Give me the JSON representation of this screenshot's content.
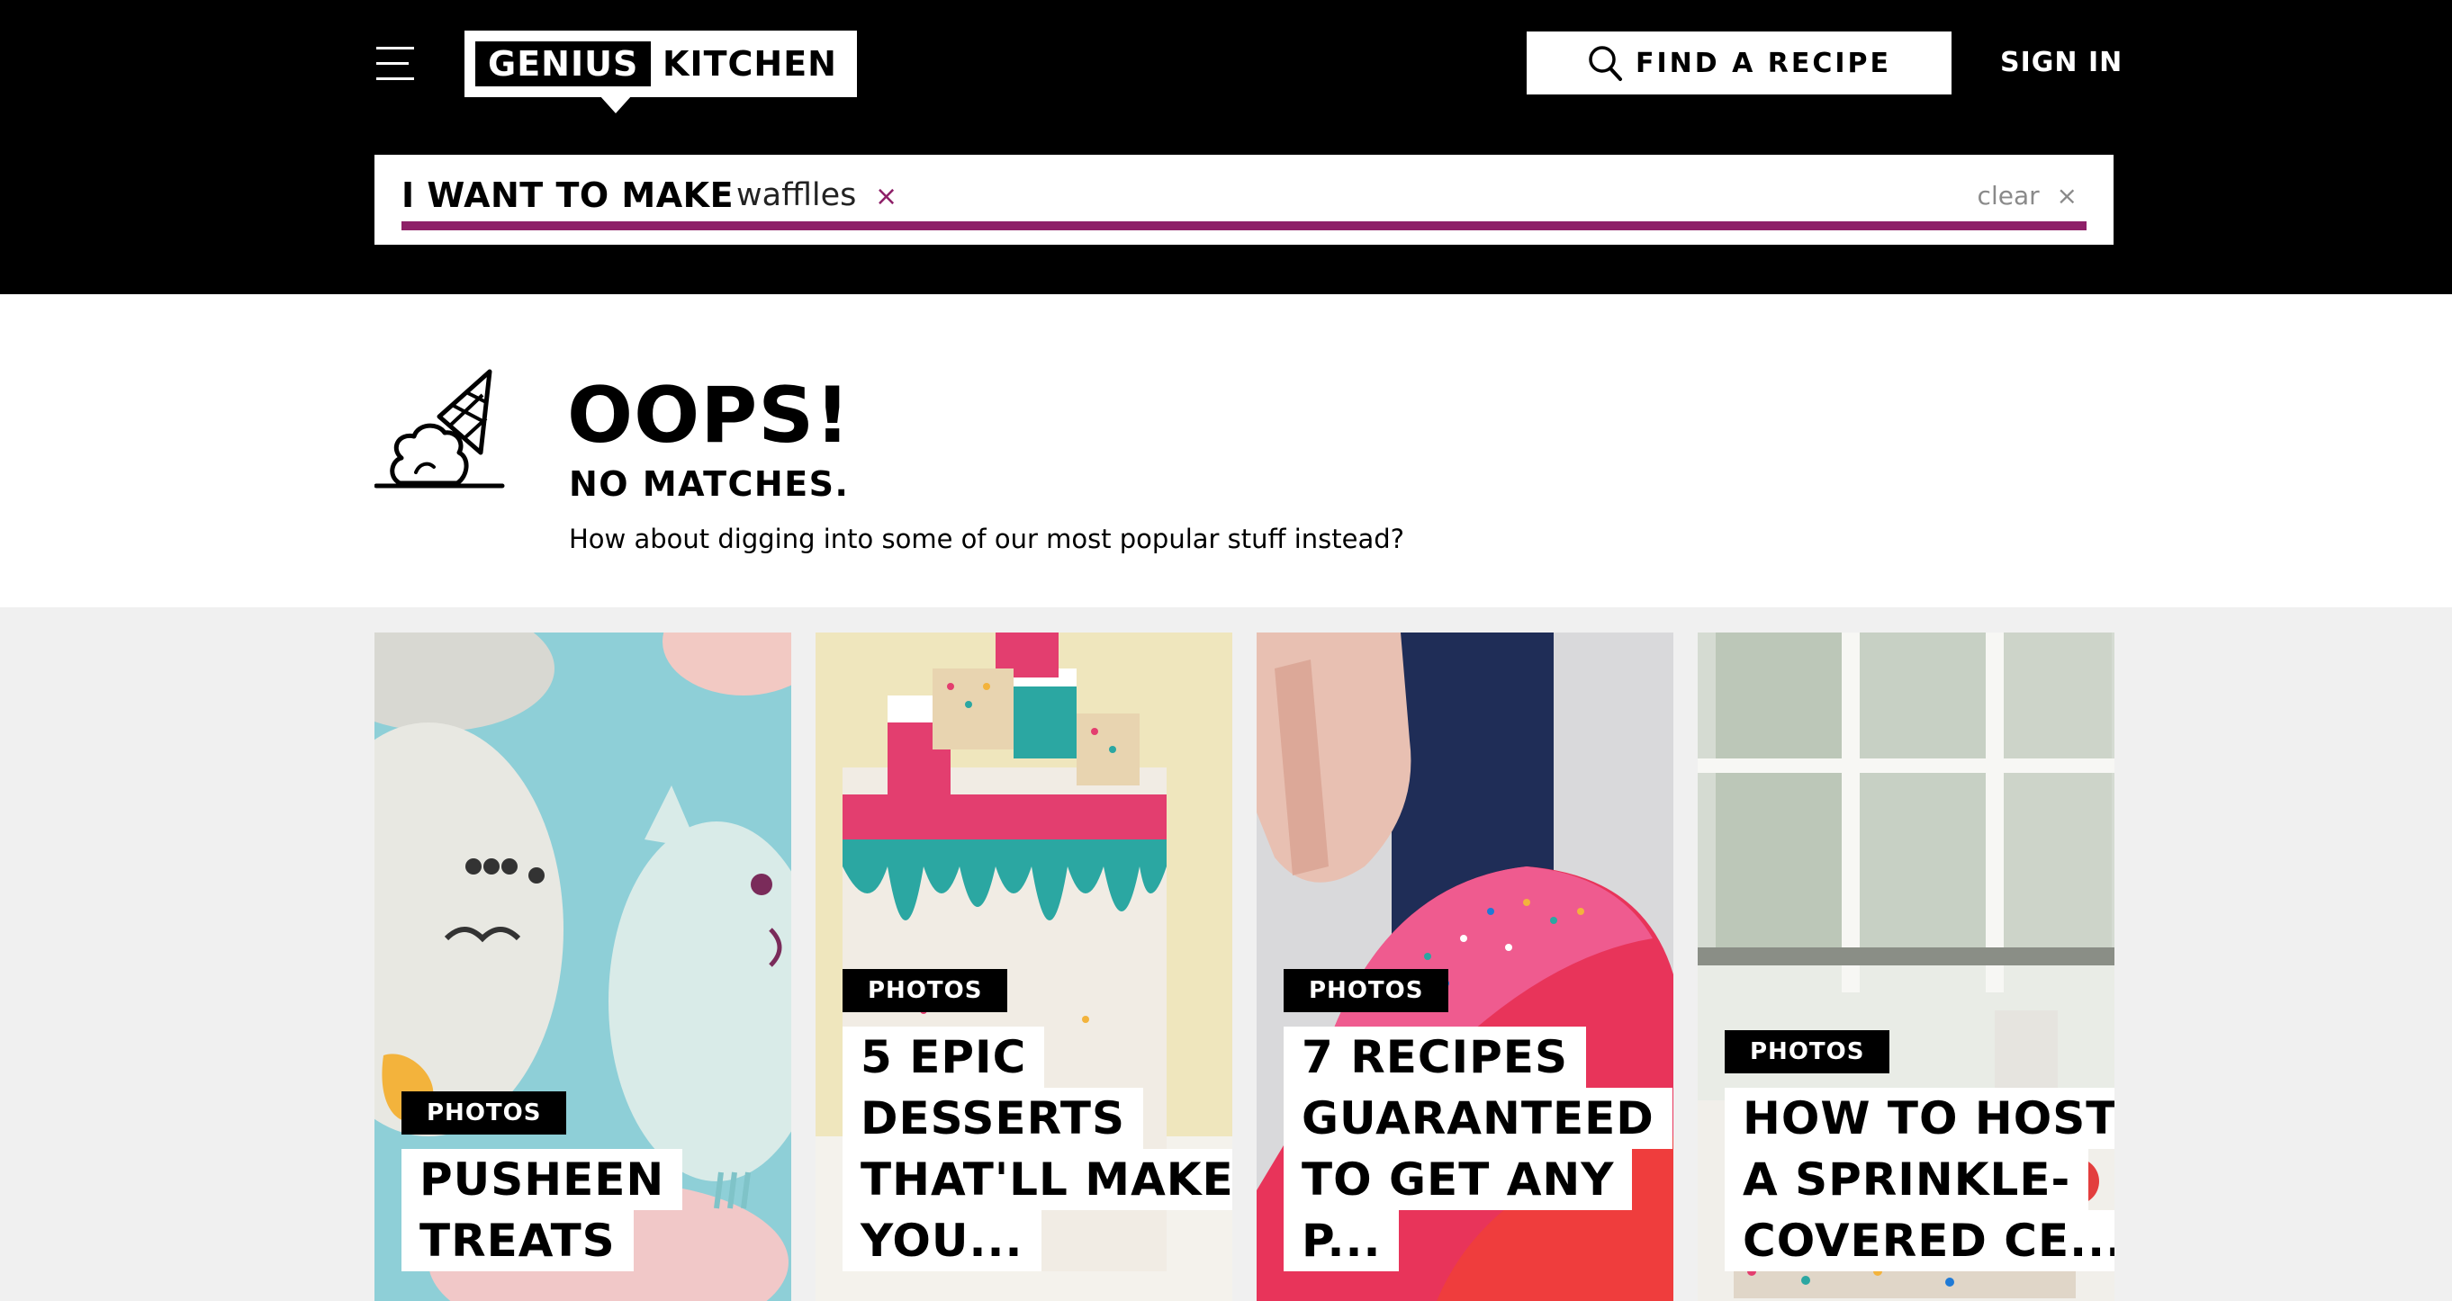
{
  "header": {
    "logo_left": "GENIUS",
    "logo_right": "KITCHEN",
    "find_label": "FIND A RECIPE",
    "signin_label": "SIGN IN"
  },
  "search": {
    "lead_label": "I WANT TO MAKE",
    "term": "wafflles",
    "term_remove": "×",
    "clear_label": "clear",
    "clear_icon": "×",
    "accent": "#8e2068"
  },
  "empty_state": {
    "title": "OOPS!",
    "subtitle": "NO MATCHES.",
    "message": "How about digging into some of our most popular stuff instead?"
  },
  "cards": [
    {
      "badge": "PHOTOS",
      "title_lines": [
        "PUSHEEN",
        "TREATS"
      ]
    },
    {
      "badge": "PHOTOS",
      "title_lines": [
        "5 EPIC",
        "DESSERTS",
        "THAT'LL MAKE",
        "YOU..."
      ]
    },
    {
      "badge": "PHOTOS",
      "title_lines": [
        "7 RECIPES",
        "GUARANTEED",
        "TO GET ANY",
        "P..."
      ]
    },
    {
      "badge": "PHOTOS",
      "title_lines": [
        "HOW TO HOST",
        "A SPRINKLE-",
        "COVERED CE..."
      ]
    }
  ],
  "icons": {
    "menu": "hamburger-menu-icon",
    "search": "search-icon",
    "empty": "dropped-ice-cream-icon"
  }
}
